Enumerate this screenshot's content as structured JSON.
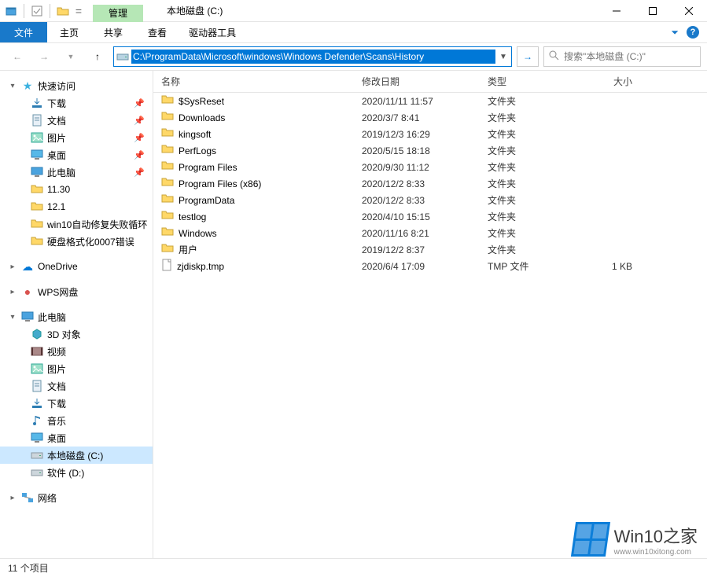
{
  "title_tab": "管理",
  "window_title": "本地磁盘 (C:)",
  "menubar": {
    "file": "文件",
    "home": "主页",
    "share": "共享",
    "view": "查看",
    "drive_tools": "驱动器工具"
  },
  "address_path": "C:\\ProgramData\\Microsoft\\windows\\Windows Defender\\Scans\\History",
  "search_placeholder": "搜索\"本地磁盘 (C:)\"",
  "columns": {
    "name": "名称",
    "date": "修改日期",
    "type": "类型",
    "size": "大小"
  },
  "sidebar": {
    "quick_access": "快速访问",
    "qa_items": [
      {
        "label": "下载",
        "icon": "download"
      },
      {
        "label": "文档",
        "icon": "doc"
      },
      {
        "label": "图片",
        "icon": "pic"
      },
      {
        "label": "桌面",
        "icon": "desktop"
      },
      {
        "label": "此电脑",
        "icon": "pc"
      },
      {
        "label": "11.30",
        "icon": "folder"
      },
      {
        "label": "12.1",
        "icon": "folder"
      },
      {
        "label": "win10自动修复失败循环",
        "icon": "folder"
      },
      {
        "label": "硬盘格式化0007错误",
        "icon": "folder"
      }
    ],
    "onedrive": "OneDrive",
    "wps": "WPS网盘",
    "this_pc": "此电脑",
    "pc_items": [
      {
        "label": "3D 对象",
        "icon": "3d"
      },
      {
        "label": "视频",
        "icon": "video"
      },
      {
        "label": "图片",
        "icon": "pic"
      },
      {
        "label": "文档",
        "icon": "doc"
      },
      {
        "label": "下载",
        "icon": "download"
      },
      {
        "label": "音乐",
        "icon": "music"
      },
      {
        "label": "桌面",
        "icon": "desktop"
      },
      {
        "label": "本地磁盘 (C:)",
        "icon": "drive",
        "selected": true
      },
      {
        "label": "软件 (D:)",
        "icon": "drive"
      }
    ],
    "network": "网络"
  },
  "files": [
    {
      "name": "$SysReset",
      "date": "2020/11/11 11:57",
      "type": "文件夹",
      "size": "",
      "icon": "folder"
    },
    {
      "name": "Downloads",
      "date": "2020/3/7 8:41",
      "type": "文件夹",
      "size": "",
      "icon": "folder"
    },
    {
      "name": "kingsoft",
      "date": "2019/12/3 16:29",
      "type": "文件夹",
      "size": "",
      "icon": "folder"
    },
    {
      "name": "PerfLogs",
      "date": "2020/5/15 18:18",
      "type": "文件夹",
      "size": "",
      "icon": "folder"
    },
    {
      "name": "Program Files",
      "date": "2020/9/30 11:12",
      "type": "文件夹",
      "size": "",
      "icon": "folder"
    },
    {
      "name": "Program Files (x86)",
      "date": "2020/12/2 8:33",
      "type": "文件夹",
      "size": "",
      "icon": "folder"
    },
    {
      "name": "ProgramData",
      "date": "2020/12/2 8:33",
      "type": "文件夹",
      "size": "",
      "icon": "folder"
    },
    {
      "name": "testlog",
      "date": "2020/4/10 15:15",
      "type": "文件夹",
      "size": "",
      "icon": "folder"
    },
    {
      "name": "Windows",
      "date": "2020/11/16 8:21",
      "type": "文件夹",
      "size": "",
      "icon": "folder"
    },
    {
      "name": "用户",
      "date": "2019/12/2 8:37",
      "type": "文件夹",
      "size": "",
      "icon": "folder"
    },
    {
      "name": "zjdiskp.tmp",
      "date": "2020/6/4 17:09",
      "type": "TMP 文件",
      "size": "1 KB",
      "icon": "file"
    }
  ],
  "status": "11 个项目",
  "watermark": {
    "title": "Win10之家",
    "url": "www.win10xitong.com"
  }
}
